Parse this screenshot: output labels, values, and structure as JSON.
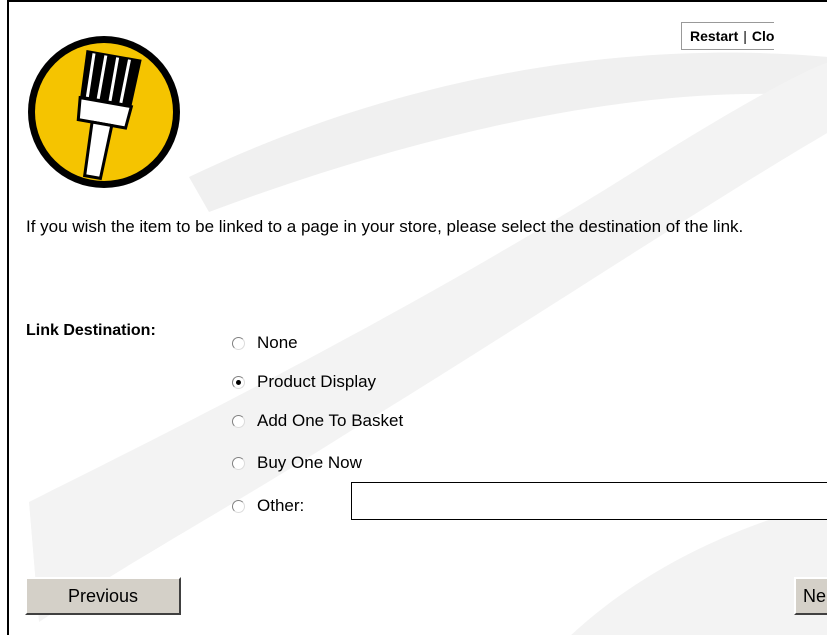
{
  "toolbar": {
    "restart_label": "Restart",
    "separator": "|",
    "close_label": "Clo"
  },
  "logo": {
    "icon": "paintbrush-icon",
    "colors": {
      "fill": "#f5c400",
      "stroke": "#000000"
    }
  },
  "instructions": "If you wish the item to be linked to a page in your store, please select the destination of the link.",
  "link_destination": {
    "label": "Link Destination:",
    "options": [
      {
        "label": "None",
        "checked": false
      },
      {
        "label": "Product Display",
        "checked": true
      },
      {
        "label": "Add One To Basket",
        "checked": false
      },
      {
        "label": "Buy One Now",
        "checked": false
      },
      {
        "label": "Other:",
        "checked": false
      }
    ],
    "other_value": ""
  },
  "buttons": {
    "previous_label": "Previous",
    "next_label": "Ne"
  }
}
